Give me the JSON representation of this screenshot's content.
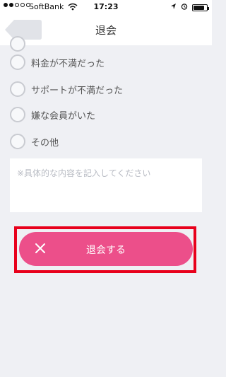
{
  "status_bar": {
    "carrier": "SoftBank",
    "time": "17:23"
  },
  "nav": {
    "title": "退会",
    "back_icon": "back-arrow-icon"
  },
  "options": [
    {
      "label": "料金が不満だった",
      "selected": false
    },
    {
      "label": "サポートが不満だった",
      "selected": false
    },
    {
      "label": "嫌な会員がいた",
      "selected": false
    },
    {
      "label": "その他",
      "selected": false
    }
  ],
  "detail": {
    "value": "",
    "placeholder": "※具体的な内容を記入してください"
  },
  "withdraw_button": {
    "label": "退会する",
    "icon": "close-icon"
  },
  "colors": {
    "accent": "#ec4f8a",
    "highlight": "#e8001b",
    "background": "#eff0f4"
  }
}
